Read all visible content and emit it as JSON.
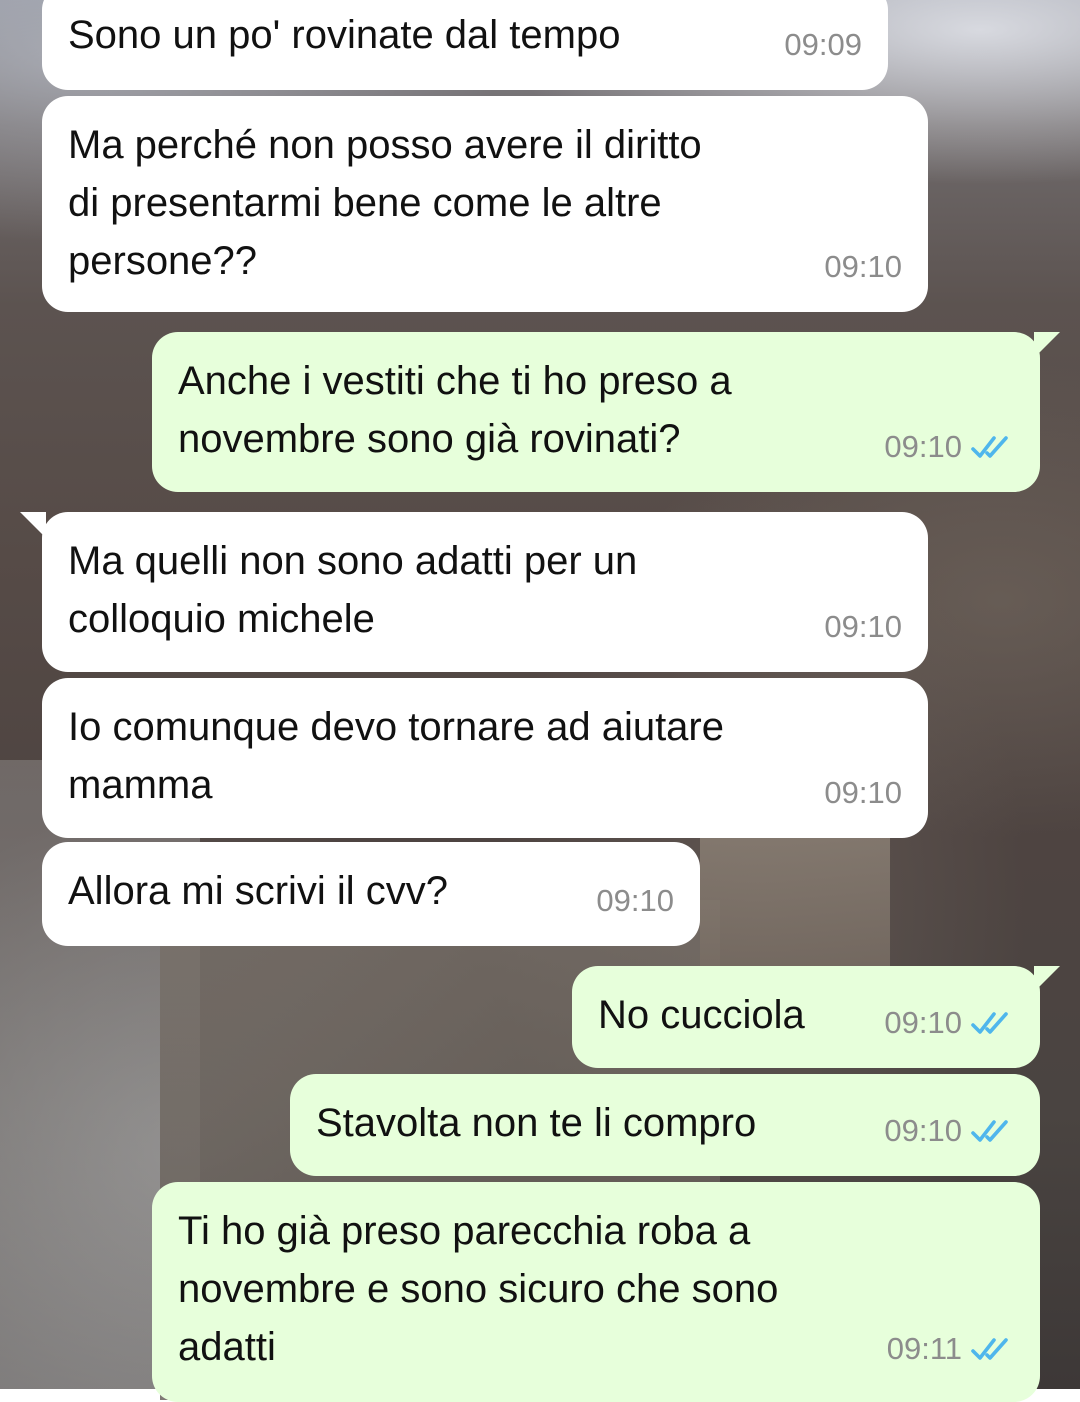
{
  "colors": {
    "incoming_bubble": "#ffffff",
    "outgoing_bubble": "#e7ffdb",
    "timestamp": "#8c8c8c",
    "read_ticks": "#4fb6ec"
  },
  "messages": [
    {
      "direction": "incoming",
      "text": "Sono un po' rovinate dal tempo",
      "time": "09:09"
    },
    {
      "direction": "incoming",
      "text": "Ma perché non posso avere il diritto\ndi presentarmi bene come le altre\npersone??",
      "time": "09:10"
    },
    {
      "direction": "outgoing",
      "text": "Anche i vestiti che ti ho preso a\nnovembre sono già rovinati?",
      "time": "09:10",
      "status_icon": "double-check-read-icon"
    },
    {
      "direction": "incoming",
      "text": "Ma quelli non sono adatti per un\ncolloquio michele",
      "time": "09:10"
    },
    {
      "direction": "incoming",
      "text": "Io comunque devo tornare ad aiutare\nmamma",
      "time": "09:10"
    },
    {
      "direction": "incoming",
      "text": "Allora mi scrivi il cvv?",
      "time": "09:10"
    },
    {
      "direction": "outgoing",
      "text": "No cucciola",
      "time": "09:10",
      "status_icon": "double-check-read-icon"
    },
    {
      "direction": "outgoing",
      "text": "Stavolta non te li compro",
      "time": "09:10",
      "status_icon": "double-check-read-icon"
    },
    {
      "direction": "outgoing",
      "text": "Ti ho già preso parecchia roba a\nnovembre e sono sicuro che sono\nadatti",
      "time": "09:11",
      "status_icon": "double-check-read-icon"
    }
  ]
}
